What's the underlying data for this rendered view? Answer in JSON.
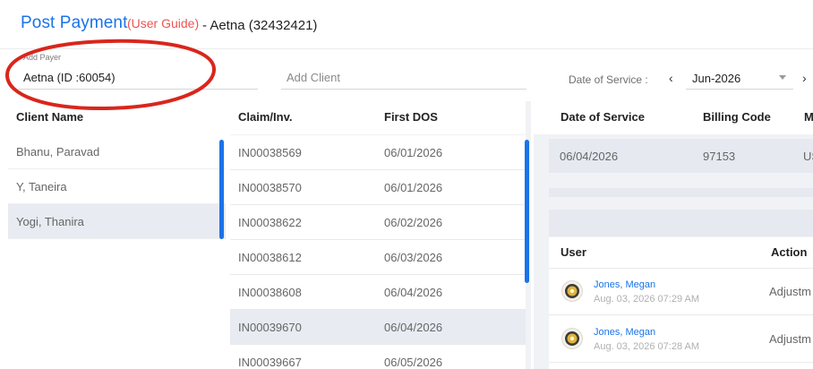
{
  "header": {
    "title": "Post Payment",
    "guide_link": "(User Guide)",
    "payer_title": "- Aetna (32432421)"
  },
  "filters": {
    "payer_label": "Add Payer",
    "payer_value": "Aetna (ID :60054)",
    "client_placeholder": "Add Client",
    "dos_label": "Date of Service :",
    "prev_icon": "‹",
    "month_value": "Jun-2026",
    "next_icon": "›"
  },
  "clients": {
    "header": "Client Name",
    "items": [
      {
        "name": "Bhanu, Paravad"
      },
      {
        "name": "Y, Taneira"
      },
      {
        "name": "Yogi, Thanira"
      }
    ],
    "selected_index": 2
  },
  "claims": {
    "headers": [
      "Claim/Inv.",
      "First DOS"
    ],
    "rows": [
      {
        "id": "IN00038569",
        "dos": "06/01/2026"
      },
      {
        "id": "IN00038570",
        "dos": "06/01/2026"
      },
      {
        "id": "IN00038622",
        "dos": "06/02/2026"
      },
      {
        "id": "IN00038612",
        "dos": "06/03/2026"
      },
      {
        "id": "IN00038608",
        "dos": "06/04/2026"
      },
      {
        "id": "IN00039670",
        "dos": "06/04/2026"
      },
      {
        "id": "IN00039667",
        "dos": "06/05/2026"
      }
    ],
    "selected_index": 5
  },
  "services": {
    "headers": [
      "Date of Service",
      "Billing Code",
      "M"
    ],
    "row": {
      "date": "06/04/2026",
      "code": "97153",
      "extra": "US"
    }
  },
  "audit": {
    "headers": [
      "User",
      "Action"
    ],
    "rows": [
      {
        "user": "Jones, Megan",
        "time": "Aug. 03, 2026 07:29 AM",
        "action": "Adjustm"
      },
      {
        "user": "Jones, Megan",
        "time": "Aug. 03, 2026 07:28 AM",
        "action": "Adjustm"
      }
    ]
  },
  "colors": {
    "accent": "#1a73e8",
    "guide": "#ef5350",
    "annotation": "#d9261c",
    "selected_row": "#e8ebf2"
  }
}
